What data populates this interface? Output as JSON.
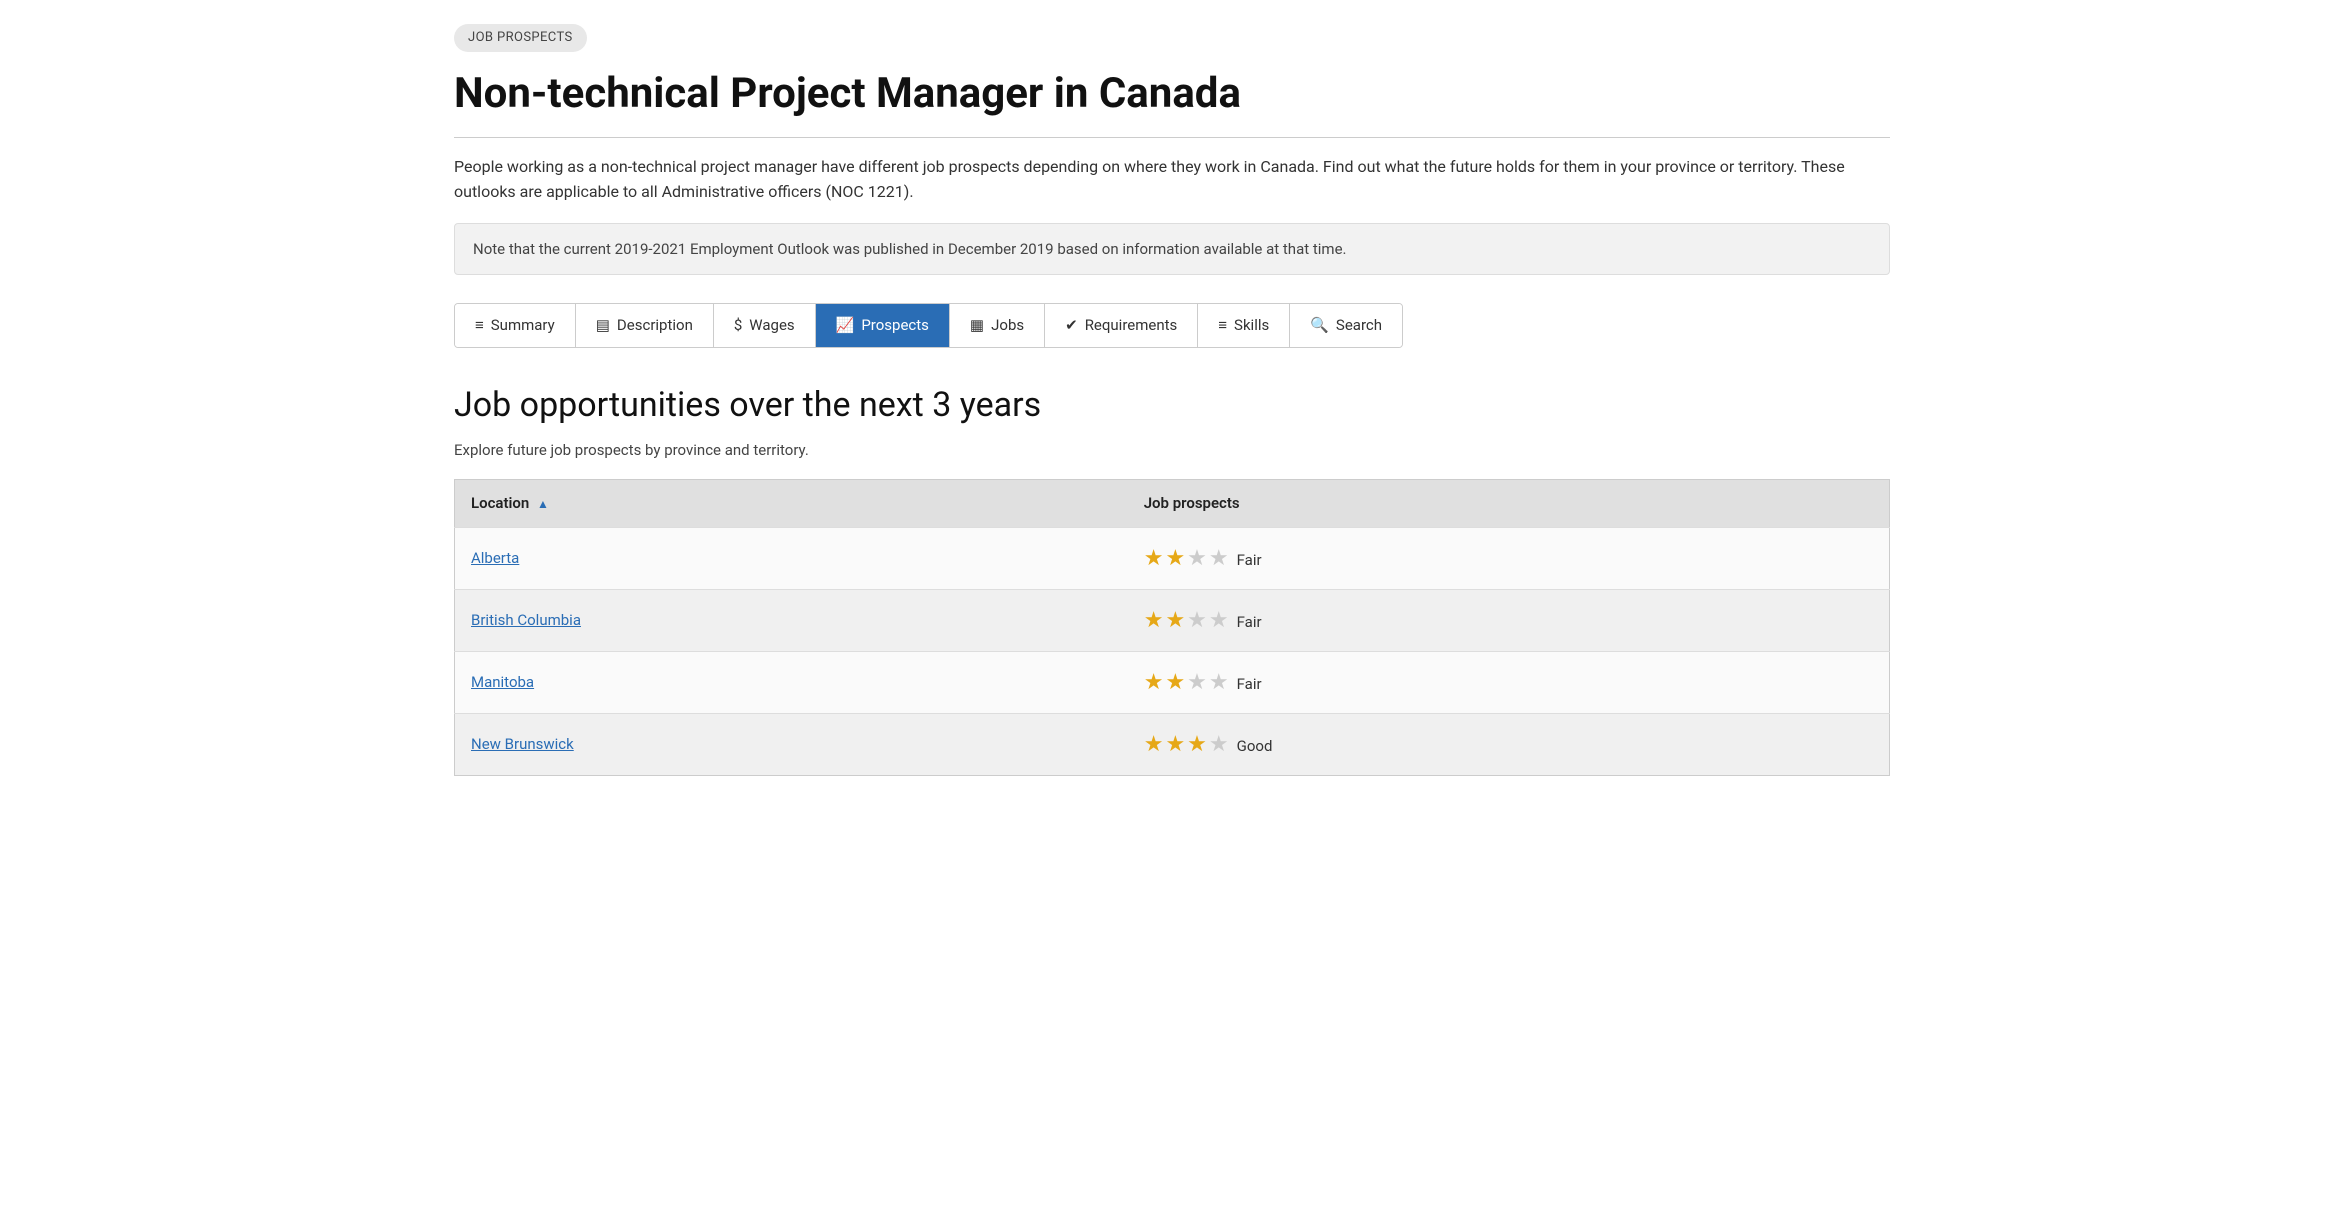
{
  "badge": "JOB PROSPECTS",
  "page_title": "Non-technical Project Manager in Canada",
  "intro_text": "People working as a non-technical project manager have different job prospects depending on where they work in Canada. Find out what the future holds for them in your province or territory. These outlooks are applicable to all Administrative officers (NOC 1221).",
  "note_text": "Note that the current 2019-2021 Employment Outlook was published in December 2019 based on information available at that time.",
  "tabs": [
    {
      "id": "summary",
      "label": "Summary",
      "icon": "≡",
      "active": false
    },
    {
      "id": "description",
      "label": "Description",
      "icon": "▤",
      "active": false
    },
    {
      "id": "wages",
      "label": "Wages",
      "icon": "$",
      "active": false
    },
    {
      "id": "prospects",
      "label": "Prospects",
      "icon": "📈",
      "active": true
    },
    {
      "id": "jobs",
      "label": "Jobs",
      "icon": "▦",
      "active": false
    },
    {
      "id": "requirements",
      "label": "Requirements",
      "icon": "✔",
      "active": false
    },
    {
      "id": "skills",
      "label": "Skills",
      "icon": "≡",
      "active": false
    },
    {
      "id": "search",
      "label": "Search",
      "icon": "🔍",
      "active": false
    }
  ],
  "section_title": "Job opportunities over the next 3 years",
  "section_subtitle": "Explore future job prospects by province and territory.",
  "table": {
    "col_location": "Location",
    "col_prospects": "Job prospects",
    "rows": [
      {
        "location": "Alberta",
        "rating": 2,
        "max": 4,
        "label": "Fair"
      },
      {
        "location": "British Columbia",
        "rating": 2,
        "max": 4,
        "label": "Fair"
      },
      {
        "location": "Manitoba",
        "rating": 2,
        "max": 4,
        "label": "Fair"
      },
      {
        "location": "New Brunswick",
        "rating": 3,
        "max": 4,
        "label": "Good"
      }
    ]
  }
}
